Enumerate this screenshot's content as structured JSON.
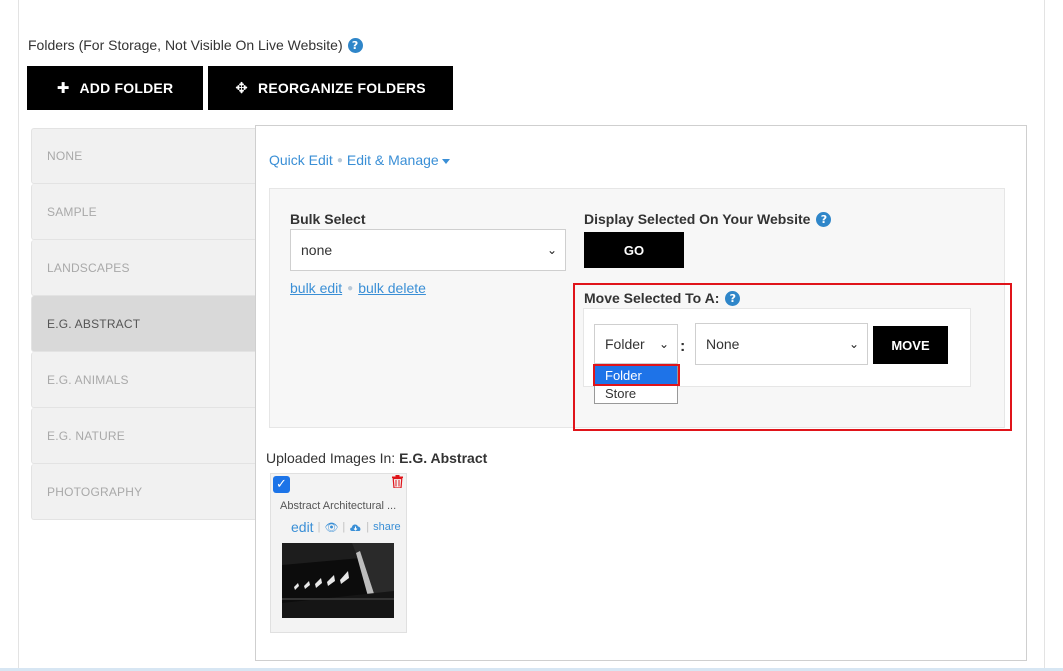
{
  "folders": {
    "heading": "Folders (For Storage, Not Visible On Live Website)",
    "add_button": "ADD FOLDER",
    "reorganize_button": "REORGANIZE FOLDERS",
    "items": [
      {
        "label": "NONE",
        "active": false
      },
      {
        "label": "SAMPLE",
        "active": false
      },
      {
        "label": "LANDSCAPES",
        "active": false
      },
      {
        "label": "E.G. ABSTRACT",
        "active": true
      },
      {
        "label": "E.G. ANIMALS",
        "active": false
      },
      {
        "label": "E.G. NATURE",
        "active": false
      },
      {
        "label": "PHOTOGRAPHY",
        "active": false
      }
    ]
  },
  "edit_mode": {
    "quick_edit": "Quick Edit",
    "edit_manage": "Edit & Manage"
  },
  "bulk": {
    "label": "Bulk Select",
    "selected_value": "none",
    "edit_link": "bulk edit",
    "delete_link": "bulk delete"
  },
  "display": {
    "label": "Display Selected On Your Website",
    "go_button": "GO"
  },
  "move": {
    "label": "Move Selected To A:",
    "type_selected": "Folder",
    "type_options": [
      "Folder",
      "Store"
    ],
    "target_selected": "None",
    "move_button": "MOVE"
  },
  "uploaded": {
    "prefix": "Uploaded Images In:",
    "folder_name": "E.G. Abstract"
  },
  "image_card": {
    "title": "Abstract Architectural ...",
    "edit": "edit",
    "share": "share",
    "checked": true
  },
  "colors": {
    "accent_blue": "#3a8fd6",
    "highlight_red": "#e0141a",
    "button_black": "#000000"
  }
}
